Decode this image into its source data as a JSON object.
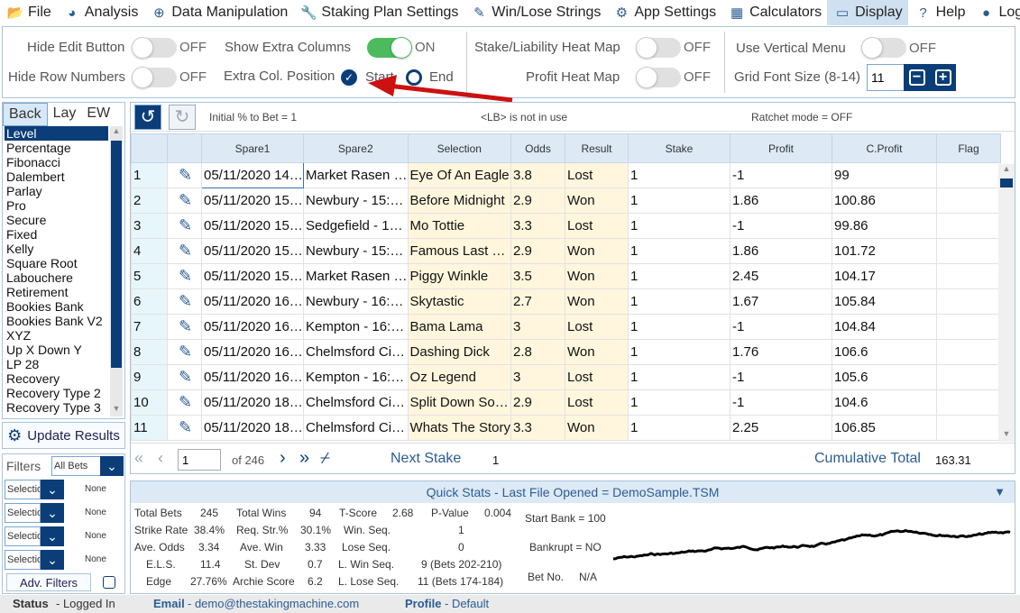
{
  "menu": [
    {
      "label": "File",
      "icon": "folder-icon"
    },
    {
      "label": "Analysis",
      "icon": "pie-chart-icon"
    },
    {
      "label": "Data Manipulation",
      "icon": "plus-circle-icon"
    },
    {
      "label": "Staking Plan Settings",
      "icon": "wrench-icon"
    },
    {
      "label": "Win/Lose Strings",
      "icon": "edit-icon"
    },
    {
      "label": "App Settings",
      "icon": "gear-icon"
    },
    {
      "label": "Calculators",
      "icon": "calculator-icon"
    },
    {
      "label": "Display",
      "icon": "monitor-icon",
      "active": true
    },
    {
      "label": "Help",
      "icon": "help-icon"
    },
    {
      "label": "Logout",
      "icon": "user-icon"
    }
  ],
  "settings": {
    "hide_edit": "Hide Edit Button",
    "hide_edit_state": "OFF",
    "hide_rows": "Hide Row Numbers",
    "hide_rows_state": "OFF",
    "show_extra": "Show Extra Columns",
    "show_extra_state": "ON",
    "extra_pos": "Extra Col. Position",
    "start": "Start",
    "end": "End",
    "heat_stake": "Stake/Liability Heat Map",
    "heat_stake_state": "OFF",
    "heat_profit": "Profit Heat Map",
    "heat_profit_state": "OFF",
    "vertical": "Use Vertical Menu",
    "vertical_state": "OFF",
    "font_size_label": "Grid Font Size (8-14)",
    "font_size": "11"
  },
  "tabs": [
    "Back",
    "Lay",
    "EW"
  ],
  "methods": [
    "Level",
    "Percentage",
    "Fibonacci",
    "Dalembert",
    "Parlay",
    "Pro",
    "Secure",
    "Fixed",
    "Kelly",
    "Square Root",
    "Labouchere",
    "Retirement",
    "Bookies Bank",
    "Bookies Bank V2",
    "XYZ",
    "Up X Down Y",
    "LP 28",
    "Recovery",
    "Recovery Type 2",
    "Recovery Type 3"
  ],
  "update_btn": "Update Results",
  "filters": {
    "label": "Filters",
    "all": "All Bets",
    "sel": "Selectio",
    "none": "None",
    "adv": "Adv. Filters"
  },
  "grid_toolbar": {
    "initial": "Initial % to Bet = 1",
    "lb": "<LB> is not in use",
    "ratchet": "Ratchet mode = OFF"
  },
  "columns": [
    "Spare1",
    "Spare2",
    "Selection",
    "Odds",
    "Result",
    "Stake",
    "Profit",
    "C.Profit",
    "Flag"
  ],
  "rows": [
    [
      "1",
      "05/11/2020 14…",
      "Market Rasen …",
      "Eye Of An Eagle",
      "3.8",
      "Lost",
      "1",
      "-1",
      "99",
      ""
    ],
    [
      "2",
      "05/11/2020 15…",
      "Newbury - 15:…",
      "Before Midnight",
      "2.9",
      "Won",
      "1",
      "1.86",
      "100.86",
      ""
    ],
    [
      "3",
      "05/11/2020 15…",
      "Sedgefield - 1…",
      "Mo Tottie",
      "3.3",
      "Lost",
      "1",
      "-1",
      "99.86",
      ""
    ],
    [
      "4",
      "05/11/2020 15…",
      "Newbury - 15:…",
      "Famous Last …",
      "2.9",
      "Won",
      "1",
      "1.86",
      "101.72",
      ""
    ],
    [
      "5",
      "05/11/2020 15…",
      "Market Rasen …",
      "Piggy Winkle",
      "3.5",
      "Won",
      "1",
      "2.45",
      "104.17",
      ""
    ],
    [
      "6",
      "05/11/2020 16…",
      "Newbury - 16:…",
      "Skytastic",
      "2.7",
      "Won",
      "1",
      "1.67",
      "105.84",
      ""
    ],
    [
      "7",
      "05/11/2020 16…",
      "Kempton - 16:…",
      "Bama Lama",
      "3",
      "Lost",
      "1",
      "-1",
      "104.84",
      ""
    ],
    [
      "8",
      "05/11/2020 16…",
      "Chelmsford Ci…",
      "Dashing Dick",
      "2.8",
      "Won",
      "1",
      "1.76",
      "106.6",
      ""
    ],
    [
      "9",
      "05/11/2020 16…",
      "Kempton - 16:…",
      "Oz Legend",
      "3",
      "Lost",
      "1",
      "-1",
      "105.6",
      ""
    ],
    [
      "10",
      "05/11/2020 18…",
      "Chelmsford Ci…",
      "Split Down So…",
      "2.9",
      "Lost",
      "1",
      "-1",
      "104.6",
      ""
    ],
    [
      "11",
      "05/11/2020 18…",
      "Chelmsford Ci…",
      "Whats The Story",
      "3.3",
      "Won",
      "1",
      "2.25",
      "106.85",
      ""
    ]
  ],
  "pager": {
    "page": "1",
    "of": "of 246",
    "next_stake_label": "Next Stake",
    "next_stake": "1",
    "cum_label": "Cumulative Total",
    "cum": "163.31"
  },
  "quick": {
    "title": "Quick Stats - Last File Opened = DemoSample.TSM",
    "tb_l": "Total Bets",
    "tb": "245",
    "tw_l": "Total Wins",
    "tw": "94",
    "ts_l": "T-Score",
    "ts": "2.68",
    "pv_l": "P-Value",
    "pv": "0.004",
    "sr_l": "Strike Rate",
    "sr": "38.4%",
    "rs_l": "Req. Str.%",
    "rs": "30.1%",
    "ws_l": "Win. Seq.",
    "ws": "1",
    "ao_l": "Ave. Odds",
    "ao": "3.34",
    "aw_l": "Ave. Win",
    "aw": "3.33",
    "ls_l": "Lose Seq.",
    "ls": "0",
    "els_l": "E.L.S.",
    "els": "11.4",
    "sd_l": "St. Dev",
    "sd": "0.7",
    "lws_l": "L. Win Seq.",
    "lws": "9 (Bets 202-210)",
    "ed_l": "Edge",
    "ed": "27.76%",
    "as_l": "Archie Score",
    "as": "6.2",
    "lls_l": "L. Lose Seq.",
    "lls": "11 (Bets 174-184)",
    "start_bank": "Start Bank = 100",
    "bankrupt": "Bankrupt = NO",
    "bet_no_l": "Bet No.",
    "bet_no": "N/A"
  },
  "status": {
    "status_l": "Status",
    "status": "- Logged In",
    "email_l": "Email",
    "email": "- demo@thestakingmachine.com",
    "profile_l": "Profile",
    "profile": "- Default"
  },
  "colors": {
    "accent": "#0b3e78",
    "toggle_on": "#4cbb5d",
    "arrow": "#cc1111"
  }
}
